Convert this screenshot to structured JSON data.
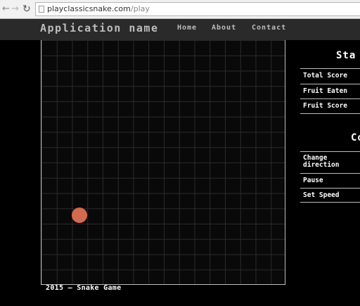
{
  "browser": {
    "url_host": "playclassicsnake.com",
    "url_path": "/play",
    "back_icon": "back-arrow-icon",
    "forward_icon": "forward-arrow-icon",
    "reload_icon": "reload-icon"
  },
  "header": {
    "app_name": "Application name",
    "nav": [
      "Home",
      "About",
      "Contact"
    ]
  },
  "game": {
    "grid_columns": 16,
    "grid_rows": 16,
    "fruit_color": "#d36a4f",
    "footer": "2015 – Snake Game"
  },
  "stats": {
    "title": "Sta",
    "rows": [
      "Total Score",
      "Fruit Eaten",
      "Fruit Score"
    ]
  },
  "controls": {
    "title": "Co",
    "rows": [
      "Change direction",
      "Pause",
      "Set Speed"
    ]
  }
}
